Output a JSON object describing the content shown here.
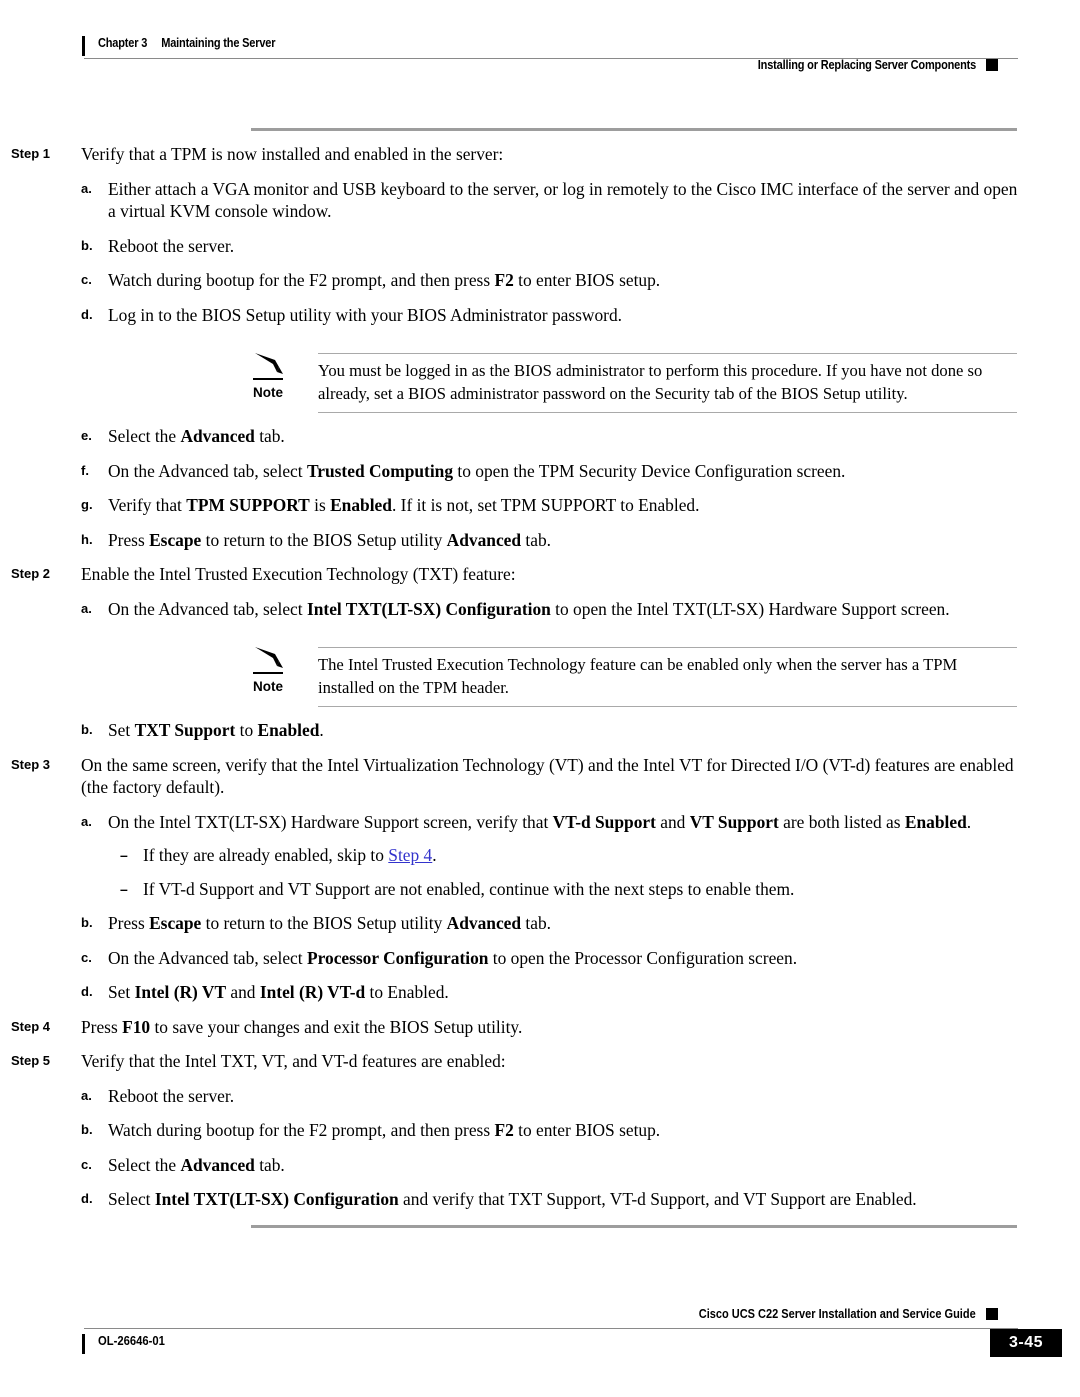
{
  "header": {
    "chapter_number": "Chapter 3",
    "chapter_title": "Maintaining the Server",
    "section_title": "Installing or Replacing Server Components"
  },
  "footer": {
    "doc_number": "OL-26646-01",
    "guide_title": "Cisco UCS C22 Server Installation and Service Guide",
    "page_number": "3-45"
  },
  "labels": {
    "note": "Note",
    "step1": "Step 1",
    "step2": "Step 2",
    "step3": "Step 3",
    "step4": "Step 4",
    "step5": "Step 5",
    "a": "a.",
    "b": "b.",
    "c": "c.",
    "d": "d.",
    "e": "e.",
    "f": "f.",
    "g": "g.",
    "h": "h.",
    "dash": "–"
  },
  "steps": {
    "step1": {
      "text": "Verify that a TPM is now installed and enabled in the server:",
      "a": "Either attach a VGA monitor and USB keyboard to the server, or log in remotely to the Cisco IMC interface of the server and open a virtual KVM console window.",
      "b": "Reboot the server.",
      "c_pre": "Watch during bootup for the F2 prompt, and then press ",
      "c_bold": "F2",
      "c_post": " to enter BIOS setup.",
      "d": "Log in to the BIOS Setup utility with your BIOS Administrator password.",
      "e_pre": "Select the ",
      "e_bold": "Advanced",
      "e_post": " tab.",
      "f_pre": "On the Advanced tab, select ",
      "f_bold": "Trusted Computing",
      "f_post": " to open the TPM Security Device Configuration screen.",
      "g_pre": "Verify that ",
      "g_bold1": "TPM SUPPORT",
      "g_mid": " is ",
      "g_bold2": "Enabled",
      "g_post": ". If it is not, set TPM SUPPORT to Enabled.",
      "h_pre": "Press ",
      "h_bold1": "Escape",
      "h_mid": " to return to the BIOS Setup utility ",
      "h_bold2": "Advanced",
      "h_post": " tab."
    },
    "note1": "You must be logged in as the BIOS administrator to perform this procedure. If you have not done so already, set a BIOS administrator password on the Security tab of the BIOS Setup utility.",
    "step2": {
      "text": "Enable the Intel Trusted Execution Technology (TXT) feature:",
      "a_pre": "On the Advanced tab, select ",
      "a_bold": "Intel TXT(LT-SX) Configuration",
      "a_post": " to open the Intel TXT(LT-SX) Hardware Support screen.",
      "b_pre": "Set ",
      "b_bold1": "TXT Support",
      "b_mid": " to ",
      "b_bold2": "Enabled",
      "b_post": "."
    },
    "note2": "The Intel Trusted Execution Technology feature can be enabled only when the server has a TPM installed on the TPM header.",
    "step3": {
      "text": "On the same screen, verify that the Intel Virtualization Technology (VT) and the Intel VT for Directed I/O (VT-d) features are enabled (the factory default).",
      "a_pre": "On the Intel TXT(LT-SX) Hardware Support screen, verify that ",
      "a_bold1": "VT-d Support",
      "a_mid": " and ",
      "a_bold2": "VT Support",
      "a_mid2": " are both listed as ",
      "a_bold3": "Enabled",
      "a_post": ".",
      "dash1_pre": "If they are already enabled, skip to ",
      "dash1_link": "Step 4",
      "dash1_post": ".",
      "dash2": "If VT-d Support and VT Support are not enabled, continue with the next steps to enable them.",
      "b_pre": "Press ",
      "b_bold1": "Escape",
      "b_mid": " to return to the BIOS Setup utility ",
      "b_bold2": "Advanced",
      "b_post": " tab.",
      "c_pre": "On the Advanced tab, select ",
      "c_bold": "Processor Configuration",
      "c_post": " to open the Processor Configuration screen.",
      "d_pre": "Set ",
      "d_bold1": "Intel (R) VT",
      "d_mid": " and ",
      "d_bold2": "Intel (R) VT-d",
      "d_post": " to Enabled."
    },
    "step4": {
      "pre": "Press ",
      "bold": "F10",
      "post": " to save your changes and exit the BIOS Setup utility."
    },
    "step5": {
      "text": "Verify that the Intel TXT, VT, and VT-d features are enabled:",
      "a": "Reboot the server.",
      "b_pre": "Watch during bootup for the F2 prompt, and then press ",
      "b_bold": "F2",
      "b_post": " to enter BIOS setup.",
      "c_pre": "Select the ",
      "c_bold": "Advanced",
      "c_post": " tab.",
      "d_pre": "Select ",
      "d_bold": "Intel TXT(LT-SX) Configuration",
      "d_post": " and verify that TXT Support, VT-d Support, and VT Support are Enabled."
    }
  },
  "colors": {
    "xref_link": "#3333cc",
    "rule_gray": "#9d9d9d",
    "page_box": "#000000"
  }
}
